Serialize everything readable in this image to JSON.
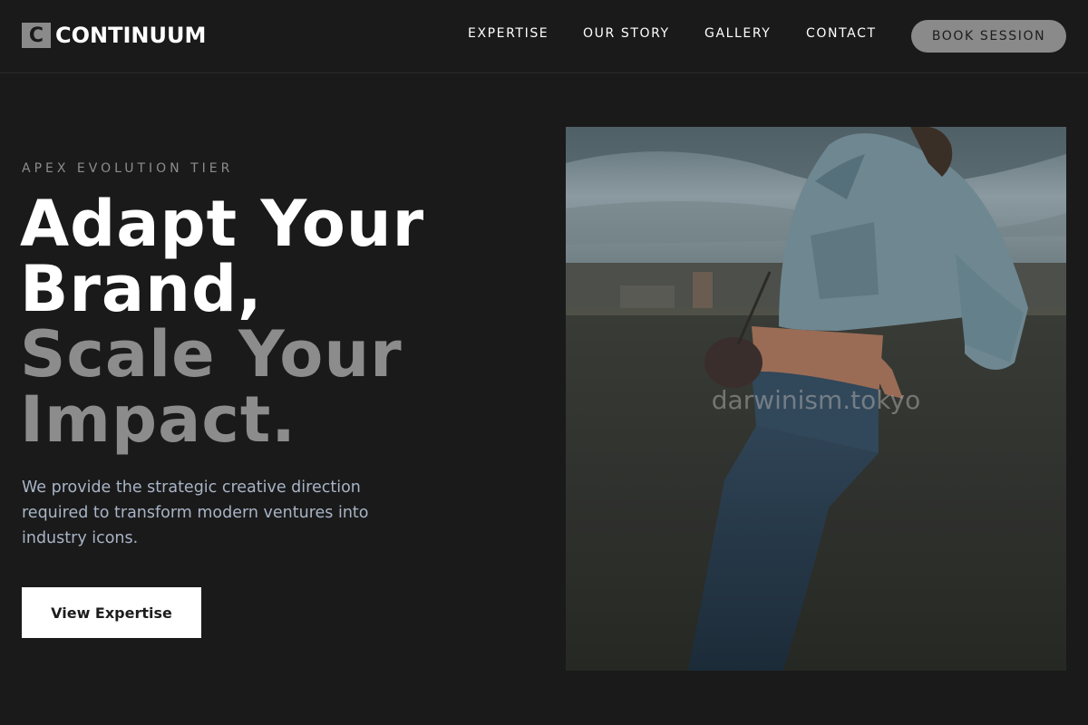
{
  "brand": {
    "mark": "C",
    "name": "CONTINUUM"
  },
  "nav": {
    "links": [
      "EXPERTISE",
      "OUR STORY",
      "GALLERY",
      "CONTACT"
    ],
    "cta": "BOOK SESSION"
  },
  "hero": {
    "eyebrow": "APEX EVOLUTION TIER",
    "headline": [
      "Adapt Your",
      "Brand,",
      "Scale Your",
      "Impact."
    ],
    "lead": "We provide the strategic creative direction required to transform modern ventures into industry icons.",
    "cta": "View Expertise",
    "image": {
      "watermark": "darwinism.tokyo",
      "subject": "model in cropped denim jacket leaning on rooftop wall"
    }
  },
  "colors": {
    "background": "#1a1a1b",
    "accent_gray": "#8c8c8c",
    "lead_text": "#a8b4c4",
    "cta_bg": "#ffffff"
  }
}
